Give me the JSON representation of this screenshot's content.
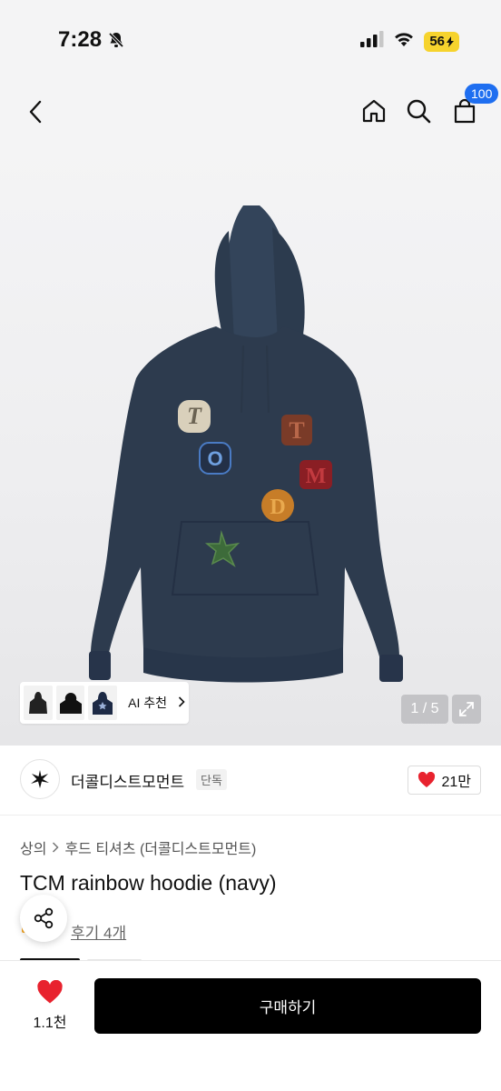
{
  "status": {
    "time": "7:28",
    "battery": "56"
  },
  "header": {
    "cart_count": "100"
  },
  "gallery": {
    "ai_label": "AI 추천",
    "counter": "1 / 5",
    "patch_letters": [
      "T",
      "O",
      "T",
      "M",
      "D"
    ]
  },
  "brand": {
    "name": "더콜디스트모먼트",
    "badge": "단독",
    "likes": "21만"
  },
  "breadcrumb": {
    "level1": "상의",
    "level2": "후드 티셔츠 (더콜디스트모먼트)"
  },
  "product": {
    "title": "TCM rainbow hoodie (navy)",
    "reviews": "후기 4개"
  },
  "bottom": {
    "wish_count": "1.1천",
    "buy_label": "구매하기"
  },
  "colors": {
    "accent_blue": "#1e6ef0",
    "heart_red": "#e8222e",
    "battery_yellow": "#f6d32d",
    "hoodie_navy": "#2d3b4e"
  }
}
